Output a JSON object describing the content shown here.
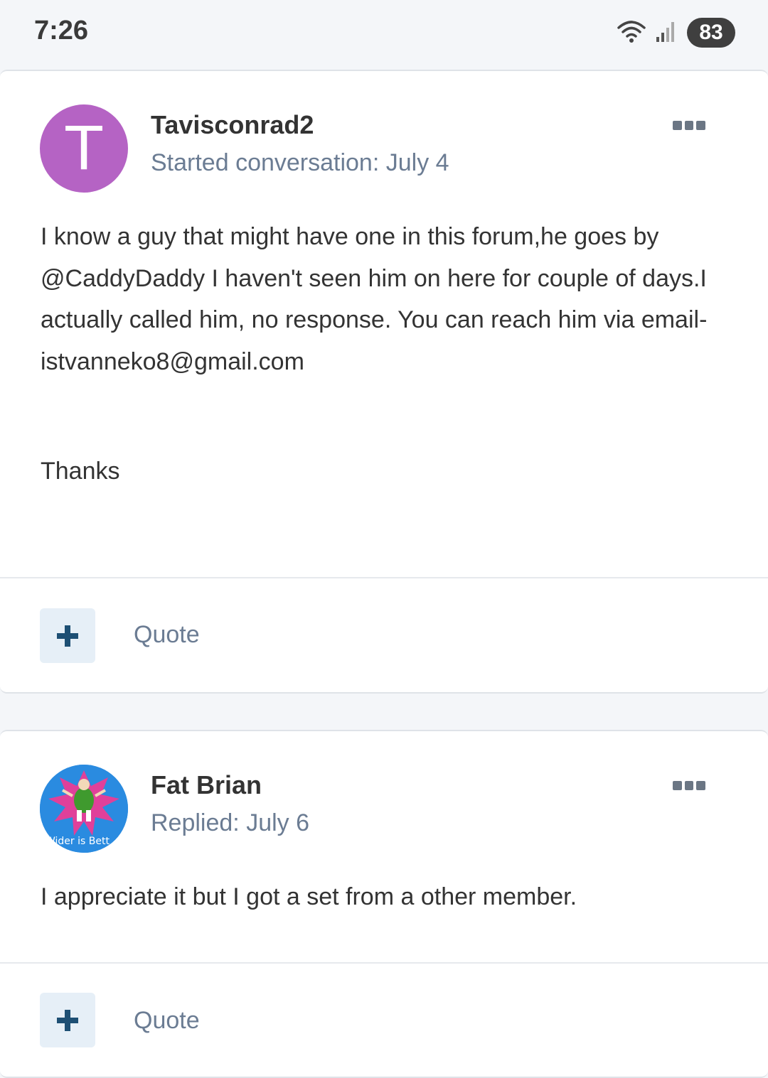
{
  "status_bar": {
    "time": "7:26",
    "battery": "83",
    "icons": [
      "wifi-icon",
      "signal-icon"
    ]
  },
  "posts": [
    {
      "avatar_letter": "T",
      "author": "Tavisconrad2",
      "meta": "Started conversation: July 4",
      "body_lines": [
        "I know a guy that might have one in this forum,he goes by @CaddyDaddy I haven't seen him on here for couple of days.I actually called him, no response. You can reach him via email- istvanneko8@gmail.com",
        "Thanks"
      ],
      "quote_label": "Quote"
    },
    {
      "avatar_caption": "Wider is Bett",
      "author": "Fat Brian",
      "meta": "Replied: July 6",
      "body_lines": [
        "I appreciate it but I got a set from a other member."
      ],
      "quote_label": "Quote"
    }
  ],
  "colors": {
    "avatar_t": "#b563c4",
    "meta_text": "#6b7c93",
    "plus_bg": "#e6eff7",
    "plus_icon": "#1d4f74"
  }
}
